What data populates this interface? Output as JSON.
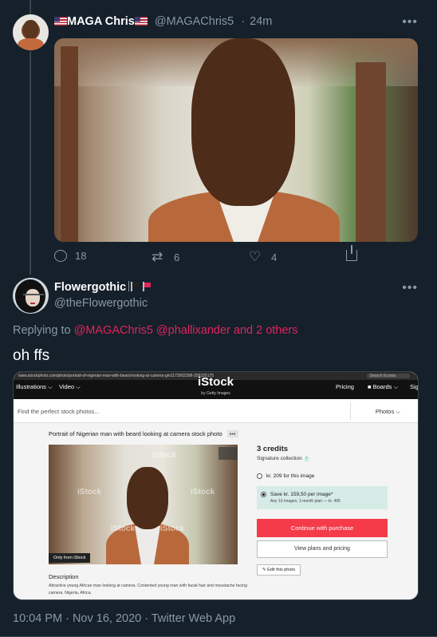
{
  "tweet1": {
    "display_name": "MAGA Chris",
    "handle": "@MAGAChris5",
    "time": "24m",
    "more": "•••",
    "actions": {
      "replies": "18",
      "retweets": "6",
      "likes": "4"
    }
  },
  "tweet2": {
    "display_name": "Flowergothic",
    "handle": "@theFlowergothic",
    "more": "•••",
    "replying_prefix": "Replying to",
    "mentions": [
      "@MAGAChris5",
      "@phallixander",
      "and 2 others"
    ],
    "text": "oh ffs",
    "timestamp": "10:04 PM · Nov 16, 2020 · Twitter Web App",
    "flag_colors": {
      "flag1": "#222222",
      "flag2": "#e0245e"
    }
  },
  "embedded_screenshot": {
    "browser": {
      "url": "www.istockphoto.com/photo/portrait-of-nigerian-man-with-beard-looking-at-camera-gm1173002398-326225175",
      "search_placeholder": "Search Ecosia"
    },
    "nav": {
      "illustrations": "Illustrations ⌵",
      "video": "Video ⌵",
      "logo": "iStock",
      "logo_sub": "by Getty Images",
      "pricing": "Pricing",
      "boards": "■ Boards ⌵",
      "sign": "Sig"
    },
    "search": {
      "placeholder": "Find the perfect stock photos...",
      "filter": "Photos ⌵"
    },
    "title": "Portrait of Nigerian man with beard looking at camera stock photo",
    "title_more": "•••",
    "watermark": "iStock",
    "only_from": "Only from iStock",
    "credits": "3 credits",
    "collection": "Signature collection",
    "collection_help": "?",
    "option1": "kr. 209 for this image",
    "option2": "Save kr. 159,50 per image*",
    "option2_sub": "Any 10 images, 1-month plan — kr. 495",
    "continue_button": "Continue with purchase",
    "plans_button": "View plans and pricing",
    "edit_button": "Edit this photo",
    "description_heading": "Description",
    "description": "Attractive young African man looking at camera. Contented young man with facial hair and moustache facing camera. Nigeria, Africa."
  },
  "colors": {
    "background": "#15202b",
    "secondary_text": "#8899a6",
    "mention": "#e0245e",
    "istock_red": "#f53a4a",
    "istock_teal": "#d5ebe6"
  }
}
